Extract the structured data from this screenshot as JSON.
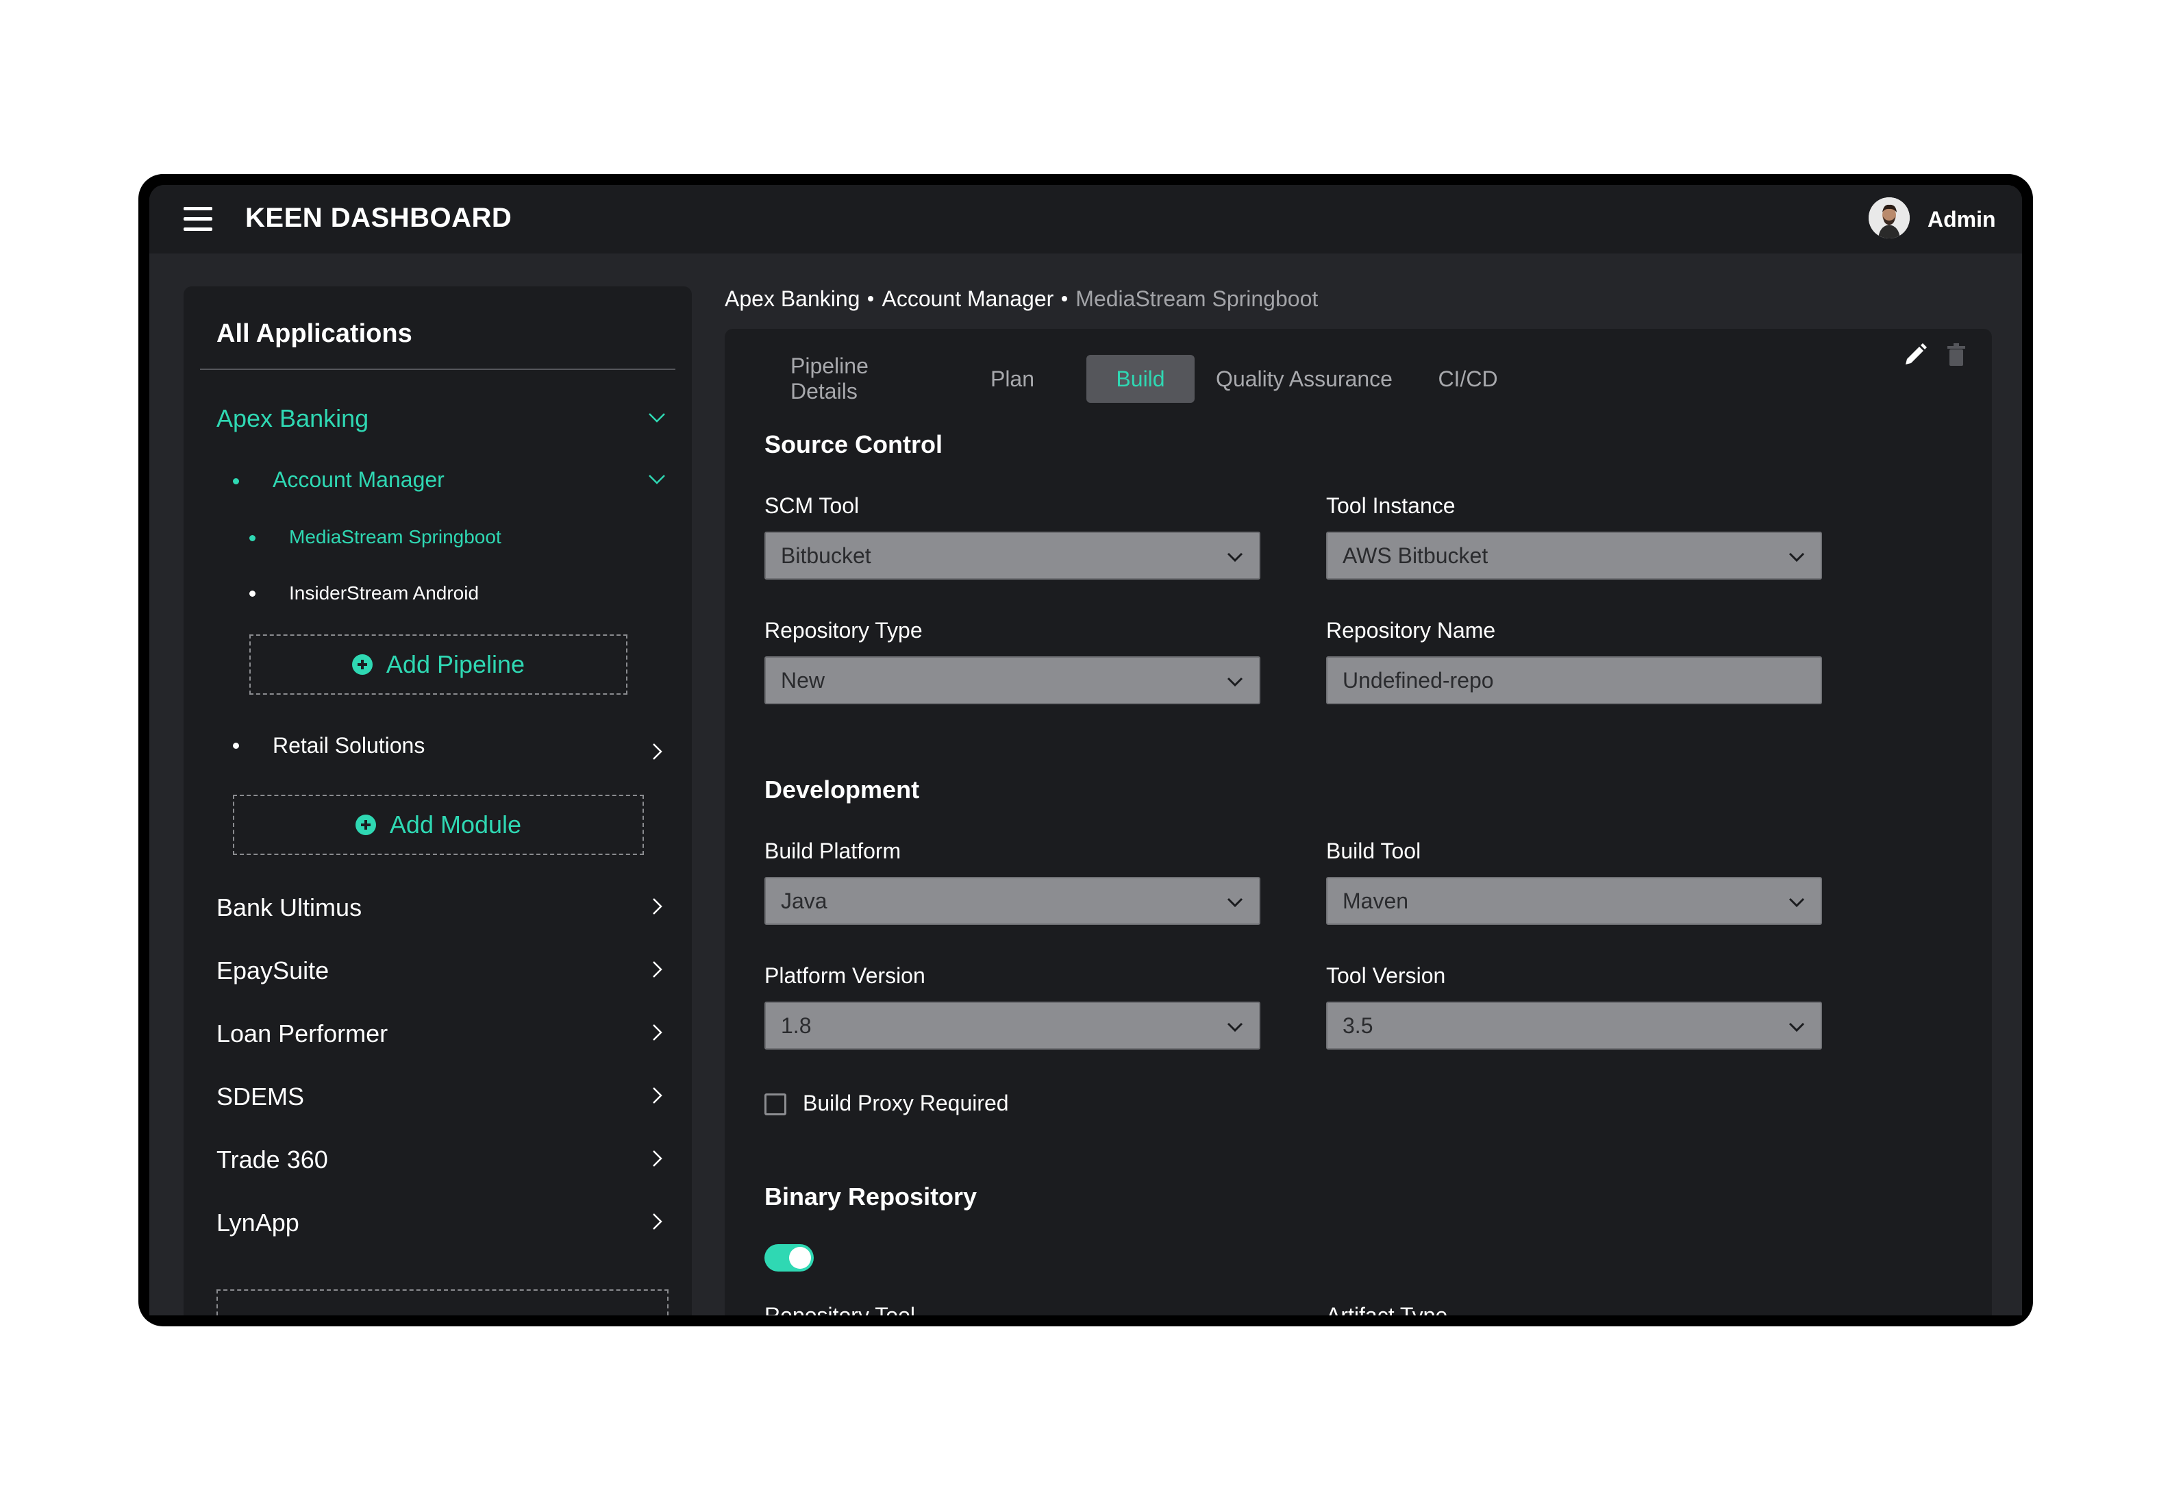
{
  "app": {
    "title": "KEEN DASHBOARD",
    "user": "Admin"
  },
  "colors": {
    "accent": "#2fd8b3",
    "background": "#25262a",
    "panel": "#1b1c1f",
    "field": "#8c8d91"
  },
  "sidebar": {
    "title": "All Applications",
    "apps": [
      {
        "label": "Apex Banking",
        "expanded": true,
        "modules": [
          {
            "label": "Account Manager",
            "expanded": true,
            "pipelines": [
              "MediaStream Springboot",
              "InsiderStream Android"
            ],
            "add_pipeline_label": "Add Pipeline"
          },
          {
            "label": "Retail Solutions",
            "expanded": false
          }
        ],
        "add_module_label": "Add Module"
      },
      {
        "label": "Bank Ultimus"
      },
      {
        "label": "EpaySuite"
      },
      {
        "label": "Loan Performer"
      },
      {
        "label": "SDEMS"
      },
      {
        "label": "Trade 360"
      },
      {
        "label": "LynApp"
      }
    ]
  },
  "breadcrumb": [
    "Apex Banking",
    "Account Manager",
    "MediaStream Springboot"
  ],
  "tabs": [
    "Pipeline Details",
    "Plan",
    "Build",
    "Quality Assurance",
    "CI/CD"
  ],
  "active_tab": "Build",
  "sections": {
    "source_control": {
      "title": "Source Control",
      "scm_tool": {
        "label": "SCM Tool",
        "value": "Bitbucket"
      },
      "tool_instance": {
        "label": "Tool Instance",
        "value": "AWS Bitbucket"
      },
      "repository_type": {
        "label": "Repository Type",
        "value": "New"
      },
      "repository_name": {
        "label": "Repository Name",
        "value": "Undefined-repo"
      }
    },
    "development": {
      "title": "Development",
      "build_platform": {
        "label": "Build Platform",
        "value": "Java"
      },
      "build_tool": {
        "label": "Build Tool",
        "value": "Maven"
      },
      "platform_version": {
        "label": "Platform Version",
        "value": "1.8"
      },
      "tool_version": {
        "label": "Tool Version",
        "value": "3.5"
      },
      "build_proxy": {
        "label": "Build Proxy Required",
        "checked": false
      }
    },
    "binary_repository": {
      "title": "Binary Repository",
      "enabled": true,
      "repository_tool_label": "Repository Tool",
      "artifact_type_label": "Artifact Type"
    }
  },
  "icons": {
    "menu": "hamburger-icon",
    "edit": "pencil-icon",
    "delete": "trash-icon",
    "expand": "chevron-down-icon",
    "collapse": "chevron-right-icon",
    "add": "plus-circle-icon"
  }
}
